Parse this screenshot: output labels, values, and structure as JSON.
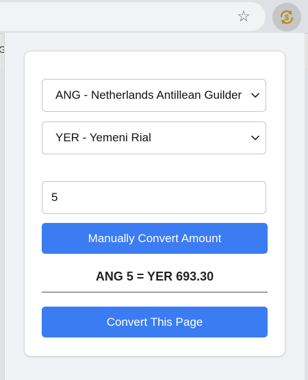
{
  "browser": {
    "star_icon": "star-icon",
    "extension_icon": "currency-converter-extension-icon",
    "page_letter": "G"
  },
  "popup": {
    "from_currency": {
      "selected": "ANG - Netherlands Antillean Guilder"
    },
    "to_currency": {
      "selected": "YER - Yemeni Rial"
    },
    "amount": {
      "value": "5"
    },
    "convert_amount_label": "Manually Convert Amount",
    "result_text": "ANG 5 = YER 693.30",
    "convert_page_label": "Convert This Page",
    "accent_color": "#3b7cf3"
  }
}
